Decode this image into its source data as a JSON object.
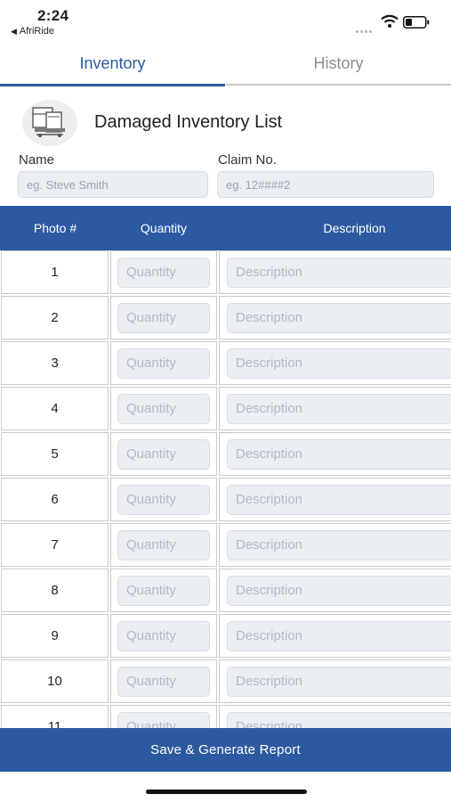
{
  "status_bar": {
    "time": "2:24",
    "back_app": "AfriRide"
  },
  "tabs": [
    {
      "label": "Inventory"
    },
    {
      "label": "History"
    }
  ],
  "header": {
    "title": "Damaged Inventory List"
  },
  "form": {
    "name_label": "Name",
    "name_placeholder": "eg. Steve Smith",
    "claim_label": "Claim No.",
    "claim_placeholder": "eg. 12####2"
  },
  "table": {
    "columns": [
      "Photo #",
      "Quantity",
      "Description"
    ],
    "quantity_placeholder": "Quantity",
    "description_placeholder": "Description",
    "rows": [
      "1",
      "2",
      "3",
      "4",
      "5",
      "6",
      "7",
      "8",
      "9",
      "10",
      "11"
    ]
  },
  "actions": {
    "save_label": "Save & Generate Report"
  },
  "colors": {
    "accent": "#2b5aa0",
    "field_bg": "#eaeef3"
  }
}
